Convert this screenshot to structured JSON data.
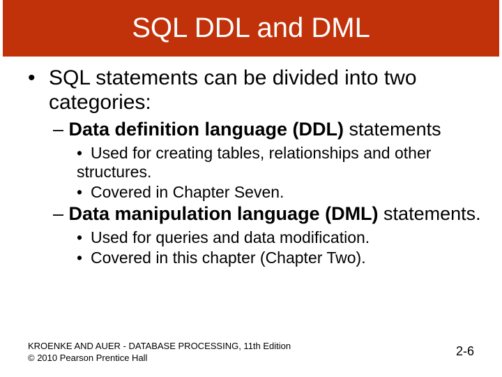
{
  "title": "SQL DDL and DML",
  "main": {
    "intro": "SQL statements can be divided into two categories:",
    "items": [
      {
        "dash": "– ",
        "label_bold": "Data definition language (DDL)",
        "label_rest": " statements",
        "subs": [
          "Used for creating tables, relationships and other structures.",
          "Covered in Chapter Seven."
        ]
      },
      {
        "dash": "– ",
        "label_bold": "Data manipulation language (DML)",
        "label_rest": " statements.",
        "subs": [
          "Used for queries and data modification.",
          "Covered in this chapter (Chapter Two)."
        ]
      }
    ]
  },
  "footer": {
    "line1": "KROENKE AND AUER - DATABASE PROCESSING, 11th Edition",
    "line2": "© 2010 Pearson Prentice Hall"
  },
  "page_number": "2-6",
  "glyphs": {
    "bullet": "•"
  }
}
